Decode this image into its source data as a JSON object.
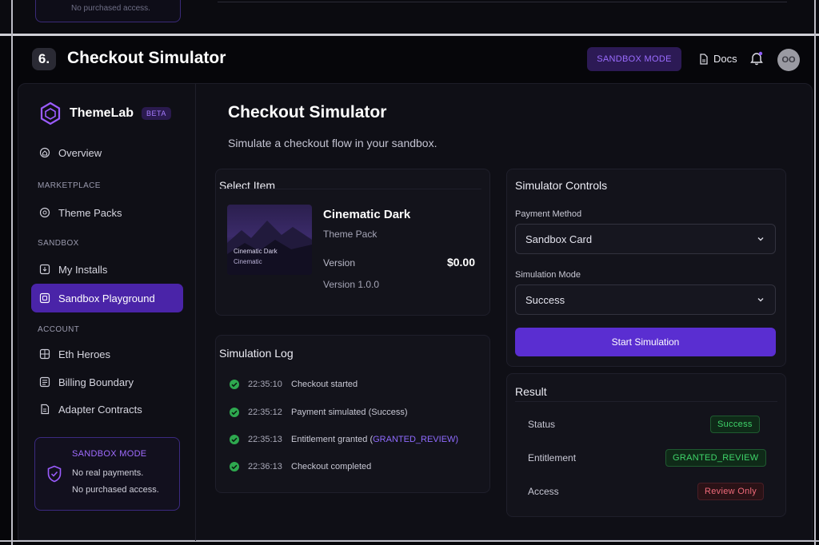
{
  "prev": {
    "note": "No purchased access."
  },
  "frame": {
    "step": "6.",
    "title": "Checkout Simulator"
  },
  "topbar": {
    "sandbox_pill": "SANDBOX MODE",
    "docs": "Docs",
    "avatar_initials": "OO"
  },
  "sidebar": {
    "brand": "ThemeLab",
    "beta": "BETA",
    "overview": "Overview",
    "sections": {
      "marketplace": "MARKETPLACE",
      "sandbox": "SANDBOX",
      "account": "ACCOUNT"
    },
    "items": {
      "theme_packs": "Theme Packs",
      "my_installs": "My Installs",
      "sandbox_playground": "Sandbox Playground",
      "eth_heroes": "Eth Heroes",
      "billing_boundary": "Billing Boundary",
      "adapter_contracts": "Adapter Contracts"
    },
    "sandbox_card": {
      "title": "SANDBOX MODE",
      "line1": "No real payments.",
      "line2": "No purchased access."
    }
  },
  "main": {
    "title": "Checkout Simulator",
    "subtitle": "Simulate a checkout flow in your sandbox."
  },
  "select_item": {
    "title": "Select Item",
    "thumb_line1": "Cinematic Dark",
    "thumb_line2": "Cinematic",
    "name": "Cinematic Dark",
    "type": "Theme Pack",
    "version_label": "Version",
    "price": "$0.00",
    "version_value": "Version 1.0.0"
  },
  "log": {
    "title": "Simulation Log",
    "rows": [
      {
        "time": "22:35:10",
        "text": "Checkout started",
        "hl": ""
      },
      {
        "time": "22:35:12",
        "text": "Payment simulated (Success)",
        "hl": ""
      },
      {
        "time": "22:35:13",
        "text": "Entitlement granted (",
        "hl": "GRANTED_REVIEW)"
      },
      {
        "time": "22:36:13",
        "text": "Checkout completed",
        "hl": ""
      }
    ]
  },
  "controls": {
    "title": "Simulator Controls",
    "payment_label": "Payment Method",
    "payment_value": "Sandbox Card",
    "mode_label": "Simulation Mode",
    "mode_value": "Success",
    "start": "Start Simulation"
  },
  "result": {
    "title": "Result",
    "status_label": "Status",
    "status_value": "Success",
    "entitlement_label": "Entitlement",
    "entitlement_value": "GRANTED_REVIEW",
    "access_label": "Access",
    "access_value": "Review Only"
  },
  "colors": {
    "accent": "#5a2ed1",
    "accent_text": "#9b6cff",
    "success": "#3fd46a",
    "danger": "#f06a7a",
    "bg": "#0f0f16"
  }
}
